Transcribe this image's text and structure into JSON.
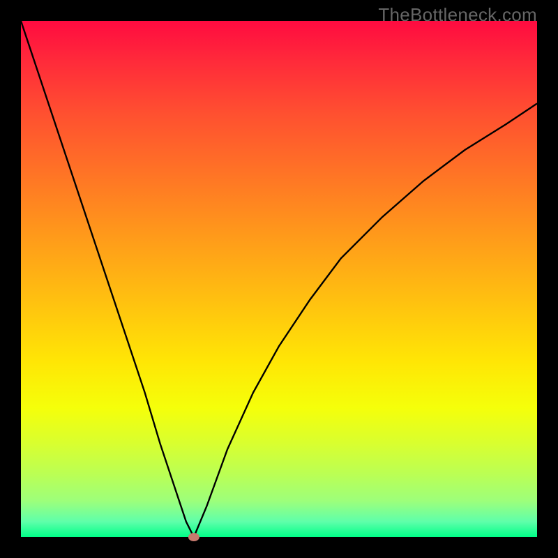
{
  "watermark": "TheBottleneck.com",
  "chart_data": {
    "type": "line",
    "title": "",
    "xlabel": "",
    "ylabel": "",
    "xlim": [
      0,
      100
    ],
    "ylim": [
      0,
      100
    ],
    "grid": false,
    "legend": false,
    "background_gradient": {
      "top": "#ff0b40",
      "bottom": "#00ff88",
      "description": "vertical red-to-green heat gradient"
    },
    "series": [
      {
        "name": "left-branch",
        "x": [
          0,
          4,
          8,
          12,
          16,
          20,
          24,
          27,
          30,
          32,
          33.5
        ],
        "values": [
          100,
          88,
          76,
          64,
          52,
          40,
          28,
          18,
          9,
          3,
          0
        ]
      },
      {
        "name": "right-branch",
        "x": [
          33.5,
          36,
          40,
          45,
          50,
          56,
          62,
          70,
          78,
          86,
          94,
          100
        ],
        "values": [
          0,
          6,
          17,
          28,
          37,
          46,
          54,
          62,
          69,
          75,
          80,
          84
        ]
      }
    ],
    "annotations": [
      {
        "name": "minimum-marker",
        "x": 33.5,
        "y": 0,
        "marker": "ellipse",
        "color": "#c77a6e"
      }
    ]
  }
}
